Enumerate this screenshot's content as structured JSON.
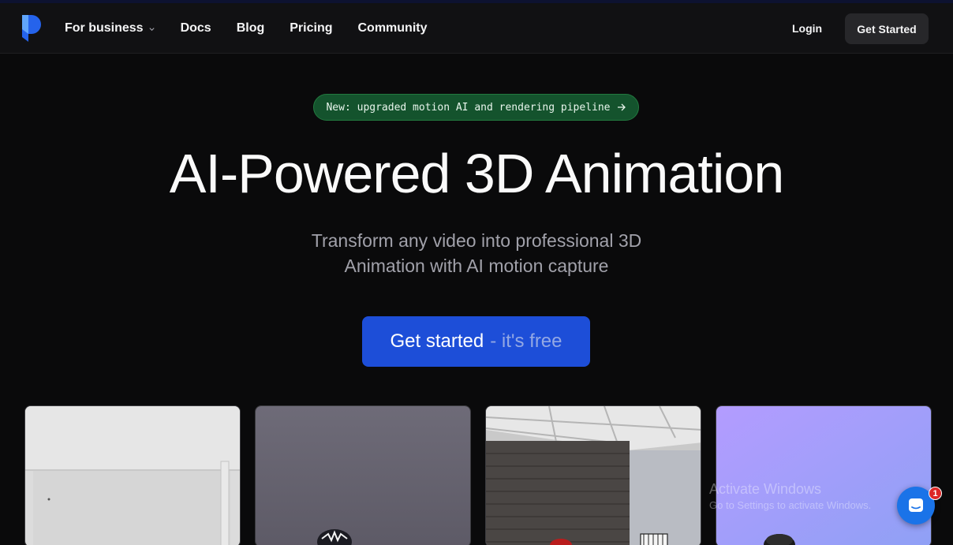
{
  "nav": {
    "links": [
      {
        "label": "For business",
        "has_dropdown": true
      },
      {
        "label": "Docs"
      },
      {
        "label": "Blog"
      },
      {
        "label": "Pricing"
      },
      {
        "label": "Community"
      }
    ],
    "login_label": "Login",
    "cta_label": "Get Started"
  },
  "hero": {
    "announcement": "New: upgraded motion AI and rendering pipeline",
    "title": "AI-Powered 3D Animation",
    "subtitle": "Transform any video into professional 3D Animation with AI motion capture",
    "cta_main": "Get started",
    "cta_suffix": "- it's free"
  },
  "watermark": {
    "title": "Activate Windows",
    "subtitle": "Go to Settings to activate Windows."
  },
  "chat": {
    "badge_count": "1"
  },
  "colors": {
    "brand": "#1d4ed8",
    "announce_bg": "#14532d",
    "background": "#0a0a0b"
  }
}
